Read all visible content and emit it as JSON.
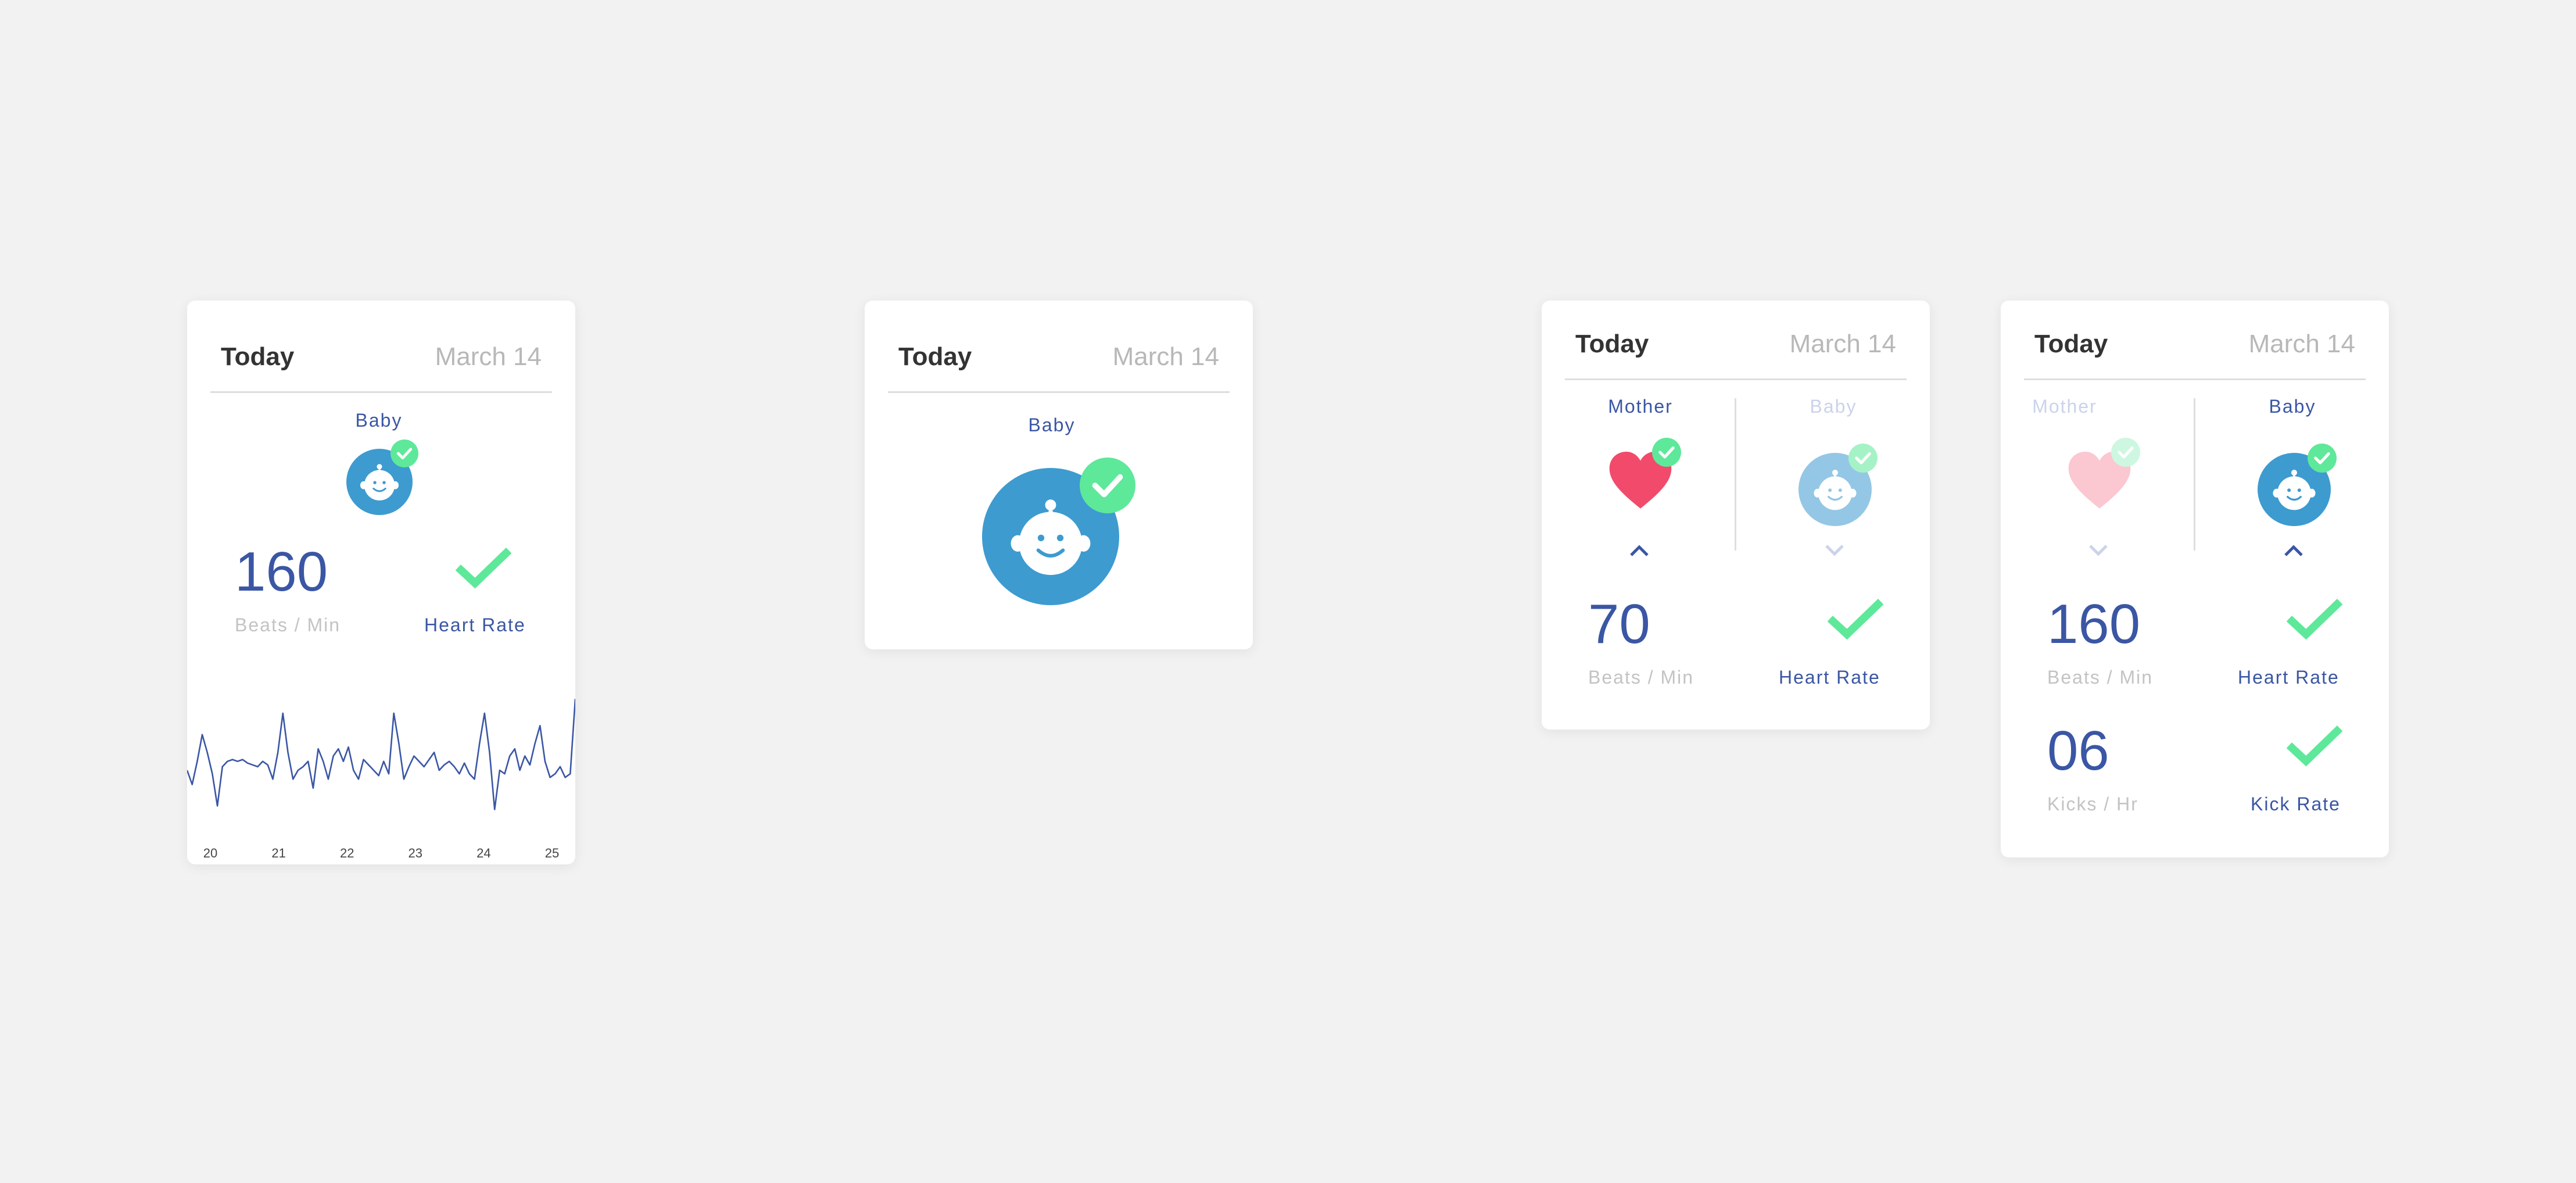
{
  "colors": {
    "accent_blue": "#3a56a4",
    "baby_blue": "#3d9bd0",
    "check_green": "#5ee89a",
    "heart_red": "#f24a6b",
    "muted_gray": "#c3c3c3"
  },
  "card1": {
    "header": {
      "title": "Today",
      "date": "March 14"
    },
    "subject_label": "Baby",
    "metric": {
      "value": "160",
      "unit": "Beats / Min",
      "caption": "Heart Rate",
      "status_icon": "check-icon"
    },
    "chart_data": {
      "type": "line",
      "x_tick_labels": [
        "20",
        "21",
        "22",
        "23",
        "24",
        "25"
      ],
      "series": [
        {
          "values": [
            50,
            42,
            55,
            70,
            60,
            48,
            30,
            52,
            55,
            56,
            55,
            56,
            54,
            53,
            52,
            55,
            53,
            45,
            60,
            82,
            60,
            45,
            50,
            52,
            55,
            40,
            62,
            55,
            45,
            58,
            62,
            55,
            63,
            50,
            45,
            56,
            53,
            50,
            47,
            55,
            48,
            82,
            65,
            45,
            52,
            58,
            55,
            52,
            56,
            60,
            50,
            53,
            55,
            52,
            48,
            54,
            48,
            45,
            65,
            82,
            60,
            28,
            50,
            48,
            58,
            62,
            50,
            58,
            53,
            65,
            75,
            55,
            46,
            48,
            52,
            46,
            48,
            90
          ],
          "ylim": [
            20,
            95
          ]
        }
      ]
    }
  },
  "card2": {
    "header": {
      "title": "Today",
      "date": "March 14"
    },
    "subject_label": "Baby"
  },
  "card3": {
    "header": {
      "title": "Today",
      "date": "March 14"
    },
    "left_label": "Mother",
    "right_label": "Baby",
    "metric": {
      "value": "70",
      "unit": "Beats / Min",
      "caption": "Heart Rate",
      "status_icon": "check-icon"
    }
  },
  "card4": {
    "header": {
      "title": "Today",
      "date": "March 14"
    },
    "left_label": "Mother",
    "right_label": "Baby",
    "metrics": [
      {
        "value": "160",
        "unit": "Beats / Min",
        "caption": "Heart Rate",
        "status_icon": "check-icon"
      },
      {
        "value": "06",
        "unit": "Kicks / Hr",
        "caption": "Kick Rate",
        "status_icon": "check-icon"
      }
    ]
  }
}
